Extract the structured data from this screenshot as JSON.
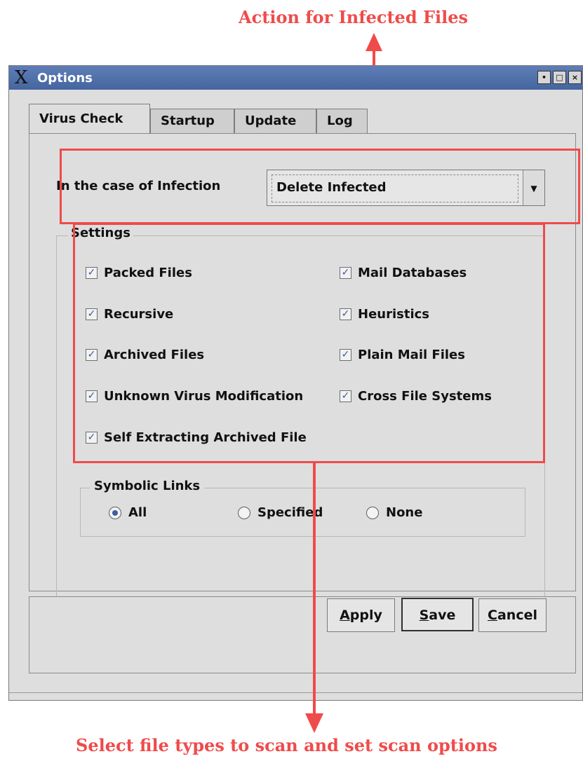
{
  "annotations": {
    "top_label": "Action for Infected Files",
    "bottom_label": "Select file types to scan and set scan options"
  },
  "window": {
    "title": "Options",
    "controls": [
      "minimize",
      "maximize",
      "close"
    ]
  },
  "tabs": [
    "Virus Check",
    "Startup",
    "Update",
    "Log"
  ],
  "active_tab": "Virus Check",
  "infection": {
    "label": "In the case of Infection",
    "selected": "Delete Infected"
  },
  "settings": {
    "title": "Settings",
    "left": [
      {
        "label": "Packed Files",
        "checked": true
      },
      {
        "label": "Recursive",
        "checked": true
      },
      {
        "label": "Archived Files",
        "checked": true
      },
      {
        "label": "Unknown Virus Modification",
        "checked": true
      },
      {
        "label": "Self Extracting Archived File",
        "checked": true
      }
    ],
    "right": [
      {
        "label": "Mail Databases",
        "checked": true
      },
      {
        "label": "Heuristics",
        "checked": true
      },
      {
        "label": "Plain Mail Files",
        "checked": true
      },
      {
        "label": "Cross File Systems",
        "checked": true
      }
    ]
  },
  "symbolic_links": {
    "title": "Symbolic Links",
    "options": [
      "All",
      "Specified",
      "None"
    ],
    "selected": "All"
  },
  "buttons": {
    "apply": {
      "mnemonic": "A",
      "rest": "pply"
    },
    "save": {
      "mnemonic": "S",
      "rest": "ave"
    },
    "cancel": {
      "mnemonic": "C",
      "rest": "ancel"
    }
  },
  "colors": {
    "annotation": "#ef4b4b",
    "titlebar": "#4f6fa9"
  }
}
